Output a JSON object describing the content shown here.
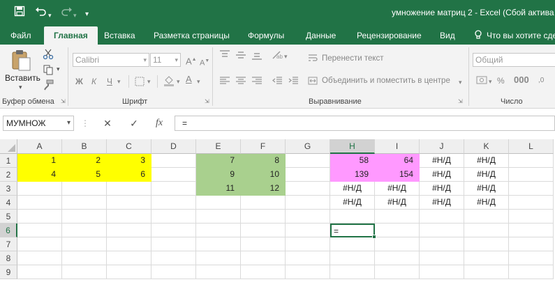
{
  "title_bar": {
    "title": "умножение матриц 2 - Excel (Сбой актива"
  },
  "tabs": {
    "file": "Файл",
    "home": "Главная",
    "insert": "Вставка",
    "layout": "Разметка страницы",
    "formulas": "Формулы",
    "data": "Данные",
    "review": "Рецензирование",
    "view": "Вид",
    "tell_me": "Что вы хотите сде"
  },
  "ribbon": {
    "paste_label": "Вставить",
    "clipboard_group": "Буфер обмена",
    "font_name": "Calibri",
    "font_size": "11",
    "font_group": "Шрифт",
    "bold": "Ж",
    "italic": "К",
    "underline": "Ч",
    "wrap_text": "Перенести текст",
    "merge_center": "Объединить и поместить в центре",
    "alignment_group": "Выравнивание",
    "number_format": "Общий",
    "number_group": "Число"
  },
  "formula_bar": {
    "name_box": "МУМНОЖ",
    "fx_label": "fx",
    "formula": "="
  },
  "sheet": {
    "columns": [
      "A",
      "B",
      "C",
      "D",
      "E",
      "F",
      "G",
      "H",
      "I",
      "J",
      "K",
      "L"
    ],
    "rows": [
      "1",
      "2",
      "3",
      "4",
      "5",
      "6",
      "7",
      "8",
      "9"
    ],
    "selected_column": "H",
    "selected_row": "6",
    "cells": {
      "A1": "1",
      "B1": "2",
      "C1": "3",
      "A2": "4",
      "B2": "5",
      "C2": "6",
      "E1": "7",
      "F1": "8",
      "E2": "9",
      "F2": "10",
      "E3": "11",
      "F3": "12",
      "H1": "58",
      "I1": "64",
      "H2": "139",
      "I2": "154",
      "J1": "#Н/Д",
      "K1": "#Н/Д",
      "J2": "#Н/Д",
      "K2": "#Н/Д",
      "H3": "#Н/Д",
      "I3": "#Н/Д",
      "J3": "#Н/Д",
      "K3": "#Н/Д",
      "H4": "#Н/Д",
      "I4": "#Н/Д",
      "J4": "#Н/Д",
      "K4": "#Н/Д",
      "H6": "="
    },
    "fills": {
      "yellow": "#ffff00",
      "green": "#a9d08e",
      "pink": "#ff99ff",
      "accent": "#217346"
    }
  }
}
